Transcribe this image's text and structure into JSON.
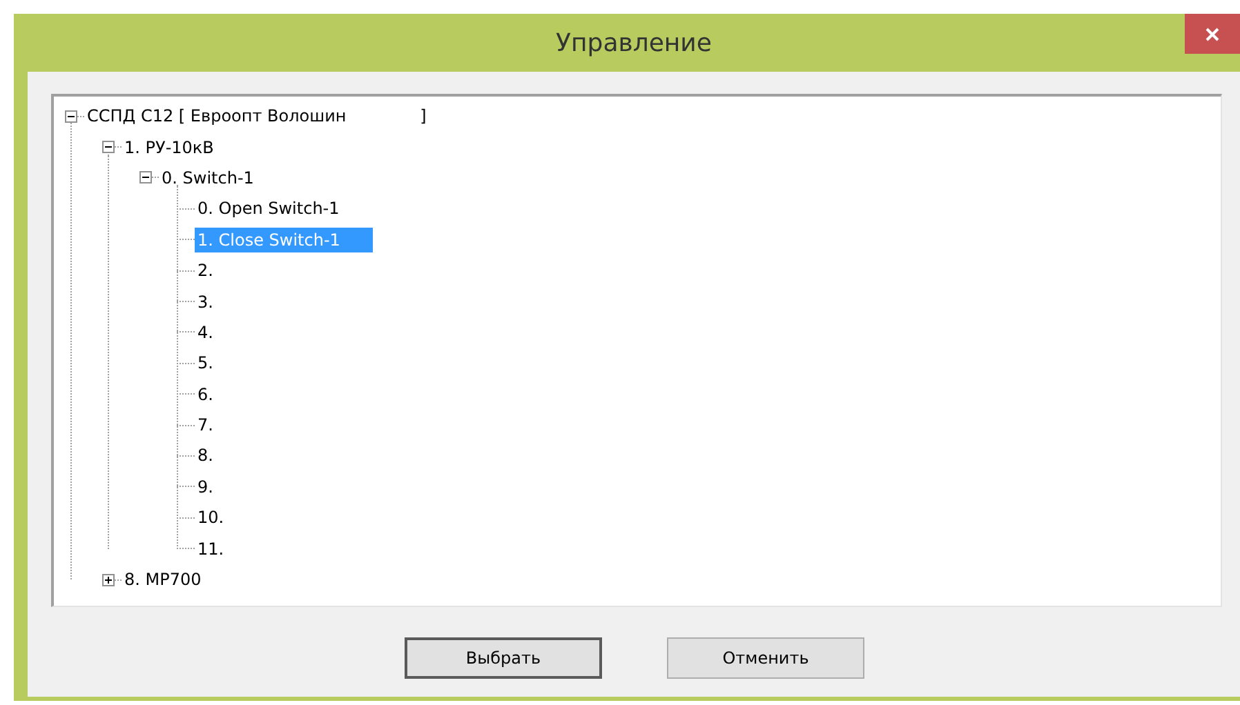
{
  "window": {
    "title": "Управление"
  },
  "tree": [
    {
      "label": "ССПД С12 [ Евроопт Волошин              ]",
      "expanded": true,
      "selected": false,
      "children": [
        {
          "label": "1. РУ-10кВ",
          "expanded": true,
          "selected": false,
          "children": [
            {
              "label": "0. Switch-1",
              "expanded": true,
              "selected": false,
              "children": [
                {
                  "label": "0. Open Switch-1",
                  "selected": false
                },
                {
                  "label": "1. Close Switch-1",
                  "selected": true
                },
                {
                  "label": "2.",
                  "selected": false
                },
                {
                  "label": "3.",
                  "selected": false
                },
                {
                  "label": "4.",
                  "selected": false
                },
                {
                  "label": "5.",
                  "selected": false
                },
                {
                  "label": "6.",
                  "selected": false
                },
                {
                  "label": "7.",
                  "selected": false
                },
                {
                  "label": "8.",
                  "selected": false
                },
                {
                  "label": "9.",
                  "selected": false
                },
                {
                  "label": "10.",
                  "selected": false
                },
                {
                  "label": "11.",
                  "selected": false
                }
              ]
            }
          ]
        },
        {
          "label": "8. MP700",
          "expanded": false,
          "selected": false
        }
      ]
    }
  ],
  "buttons": [
    {
      "label": "Выбрать",
      "kind": "default"
    },
    {
      "label": "Отменить",
      "kind": "normal"
    }
  ]
}
